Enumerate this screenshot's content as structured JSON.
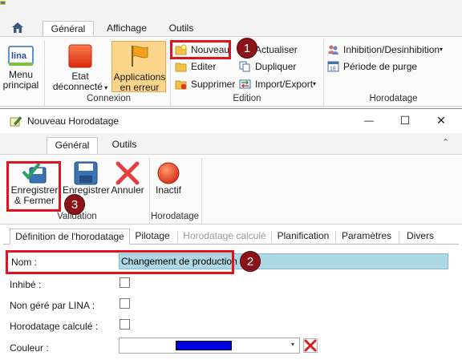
{
  "ribbon": {
    "tabs": [
      {
        "label": "Général",
        "active": true
      },
      {
        "label": "Affichage",
        "active": false
      },
      {
        "label": "Outils",
        "active": false
      }
    ],
    "menu_principal": {
      "line1": "Menu",
      "line2": "principal",
      "logo": "lina"
    },
    "connexion": {
      "etat_line1": "Etat",
      "etat_line2": "déconnecté",
      "applications_line1": "Applications",
      "applications_line2": "en erreur",
      "group_label": "Connexion"
    },
    "edition": {
      "nouveau": "Nouveau",
      "editer": "Editer",
      "supprimer": "Supprimer",
      "actualiser": "Actualiser",
      "dupliquer": "Dupliquer",
      "import_export": "Import/Export",
      "group_label": "Edition"
    },
    "horodatage": {
      "inhibition": "Inhibition/Desinhibition",
      "periode": "Période de purge",
      "calendar_day": "18",
      "group_label": "Horodatage"
    }
  },
  "dialog": {
    "title": "Nouveau Horodatage",
    "controls": {
      "minimize": "—",
      "maximize": "☐",
      "close": "✕"
    },
    "ribbon_tabs": [
      {
        "label": "Général",
        "active": true
      },
      {
        "label": "Outils",
        "active": false
      }
    ],
    "collapse_glyph": "⌃",
    "validation": {
      "save_close_line1": "Enregistrer",
      "save_close_line2": "& Fermer",
      "save": "Enregistrer",
      "cancel": "Annuler",
      "group_label": "Validation"
    },
    "horodatage": {
      "inactif": "Inactif",
      "group_label": "Horodatage"
    },
    "form_tabs": [
      {
        "label": "Définition de l'horodatage",
        "state": "active"
      },
      {
        "label": "Pilotage",
        "state": "normal"
      },
      {
        "label": "Horodatage calculé",
        "state": "disabled"
      },
      {
        "label": "Planification",
        "state": "normal"
      },
      {
        "label": "Paramètres",
        "state": "normal"
      },
      {
        "label": "Divers",
        "state": "normal"
      }
    ],
    "form": {
      "nom_label": "Nom :",
      "nom_value": "Changement de production",
      "inhibe_label": "Inhibé :",
      "non_gere_label": "Non géré par LINA :",
      "calcule_label": "Horodatage calculé :",
      "couleur_label": "Couleur :",
      "couleur_value": "#0000e0"
    }
  },
  "callouts": [
    "1",
    "2",
    "3"
  ],
  "colors": {
    "callout_red": "#e0141e",
    "badge": "#8b1217",
    "selection": "#add8e6"
  }
}
